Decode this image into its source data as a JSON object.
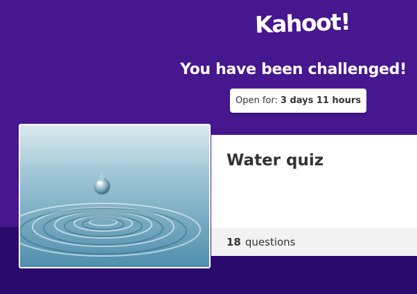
{
  "logo": {
    "text": "Kahoot!"
  },
  "headline": "You have been challenged!",
  "timer": {
    "label": "Open for:",
    "value": "3 days 11 hours"
  },
  "quiz": {
    "title": "Water quiz",
    "question_count": "18",
    "question_label": "questions",
    "image_icon": "water-drop-image"
  },
  "colors": {
    "background": "#46178f",
    "background_lower": "#2b0a6e",
    "card": "#ffffff",
    "card_footer": "#f2f2f2"
  }
}
